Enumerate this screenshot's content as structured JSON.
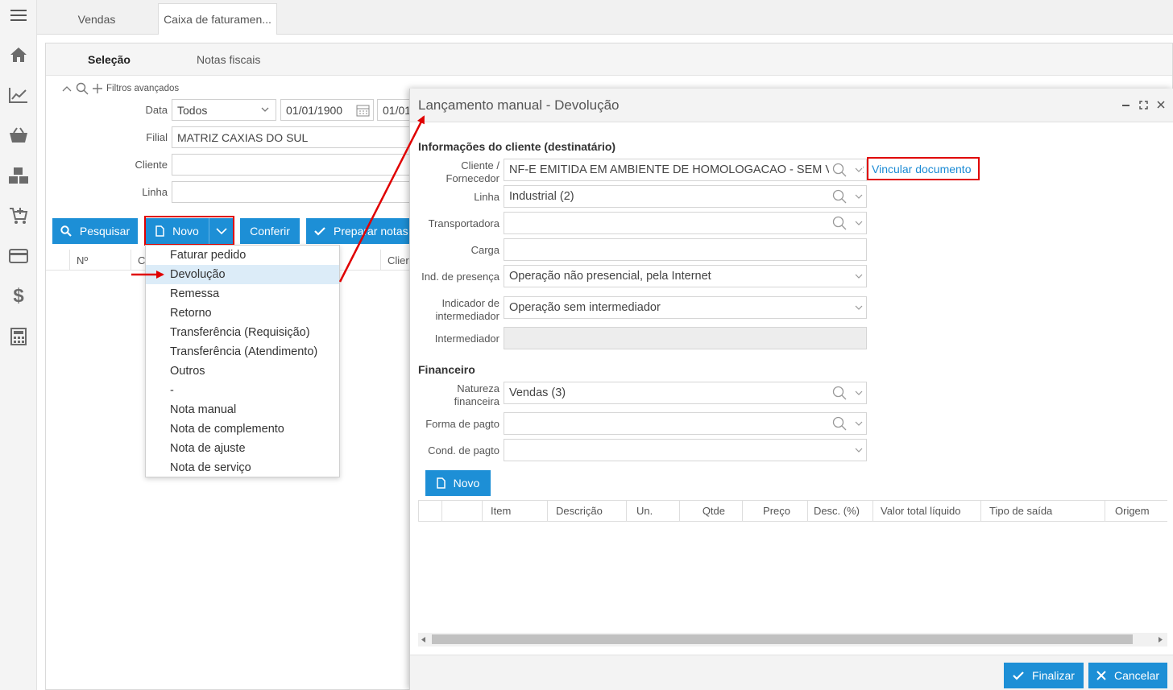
{
  "tabs": {
    "vendas": "Vendas",
    "caixa": "Caixa de faturamen..."
  },
  "subtabs": {
    "selecao": "Seleção",
    "notas": "Notas fiscais"
  },
  "filters": {
    "advanced": "Filtros avançados",
    "data_label": "Data",
    "data_value": "Todos",
    "date_from": "01/01/1900",
    "date_to": "01/01",
    "filial_label": "Filial",
    "filial_value": "MATRIZ CAXIAS DO SUL",
    "cliente_label": "Cliente",
    "linha_label": "Linha"
  },
  "toolbar": {
    "pesquisar": "Pesquisar",
    "novo": "Novo",
    "conferir": "Conferir",
    "preparar": "Preparar notas"
  },
  "grid": {
    "col_n": "Nº",
    "col_c": "C",
    "col_cli": "Clier"
  },
  "dropdown": {
    "items": [
      "Faturar pedido",
      "Devolução",
      "Remessa",
      "Retorno",
      "Transferência (Requisição)",
      "Transferência (Atendimento)",
      "Outros",
      "-",
      "Nota manual",
      "Nota de complemento",
      "Nota de ajuste",
      "Nota de serviço"
    ]
  },
  "modal": {
    "title": "Lançamento manual - Devolução",
    "section_client": "Informações do cliente (destinatário)",
    "cliente_label_1": "Cliente /",
    "cliente_label_2": "Fornecedor",
    "cliente_value": "NF-E EMITIDA EM AMBIENTE DE HOMOLOGACAO - SEM VALOR FISCAL",
    "vincular": "Vincular documento",
    "linha_label": "Linha",
    "linha_value": "Industrial (2)",
    "transportadora_label": "Transportadora",
    "carga_label": "Carga",
    "presenca_label": "Ind. de presença",
    "presenca_value": "Operação não presencial, pela Internet",
    "indicador_label_1": "Indicador de",
    "indicador_label_2": "intermediador",
    "indicador_value": "Operação sem intermediador",
    "intermediador_label": "Intermediador",
    "section_fin": "Financeiro",
    "natureza_label_1": "Natureza",
    "natureza_label_2": "financeira",
    "natureza_value": "Vendas (3)",
    "forma_label": "Forma de pagto",
    "cond_label": "Cond. de pagto",
    "novo": "Novo",
    "grid_cols": [
      "Item",
      "Descrição",
      "Un.",
      "Qtde",
      "Preço",
      "Desc. (%)",
      "Valor total líquido",
      "Tipo de saída",
      "Origem"
    ],
    "finalizar": "Finalizar",
    "cancelar": "Cancelar"
  },
  "colors": {
    "primary": "#1d8fd6",
    "highlight": "#e00000",
    "link": "#1a8ad4"
  }
}
